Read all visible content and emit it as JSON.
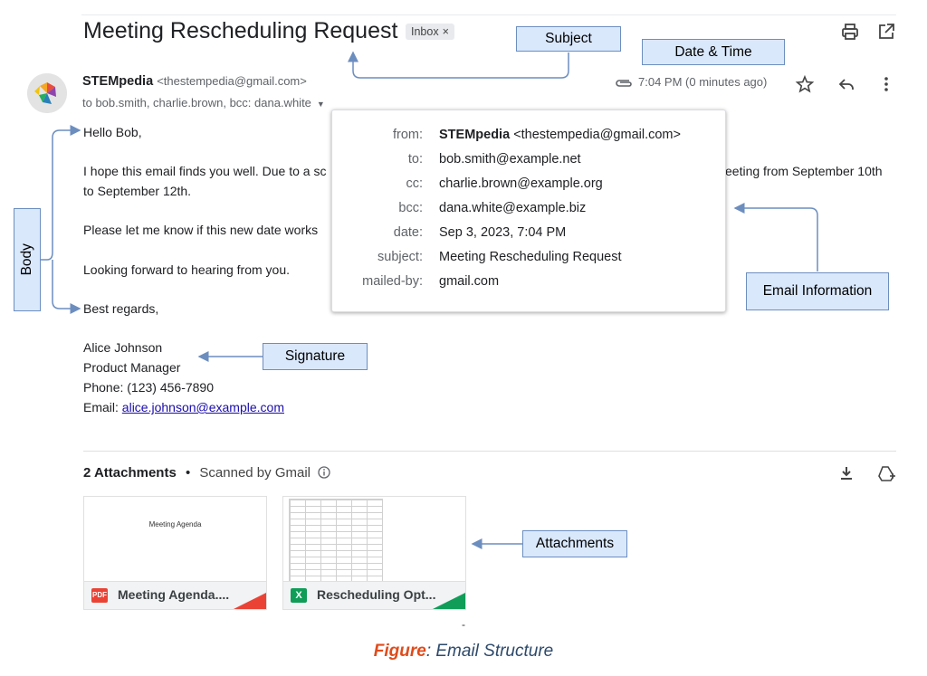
{
  "email": {
    "subject": "Meeting Rescheduling Request",
    "label_badge": "Inbox",
    "label_close": "×",
    "sender_name": "STEMpedia",
    "sender_addr": "<thestempedia@gmail.com>",
    "recipients": "to bob.smith, charlie.brown, bcc: dana.white",
    "datetime": "7:04 PM (0 minutes ago)",
    "body": {
      "greeting": "Hello Bob,",
      "para1_start": "I hope this email finds you well. Due to a sc",
      "para1_end": "eeting from September 10th",
      "para1_line2": "to September 12th.",
      "para2": "Please let me know if this new date works",
      "para3": "Looking forward to hearing from you.",
      "closing": "Best regards,"
    },
    "signature": {
      "name": "Alice Johnson",
      "title": "Product Manager",
      "phone": "Phone: (123) 456-7890",
      "email_label": "Email: ",
      "email": "alice.johnson@example.com"
    }
  },
  "details": {
    "from_label": "from:",
    "from_name": "STEMpedia",
    "from_addr": "<thestempedia@gmail.com>",
    "to_label": "to:",
    "to": "bob.smith@example.net",
    "cc_label": "cc:",
    "cc": "charlie.brown@example.org",
    "bcc_label": "bcc:",
    "bcc": "dana.white@example.biz",
    "date_label": "date:",
    "date": "Sep 3, 2023, 7:04 PM",
    "subject_label": "subject:",
    "subject": "Meeting Rescheduling Request",
    "mailedby_label": "mailed-by:",
    "mailedby": "gmail.com"
  },
  "attachments": {
    "count_label": "2 Attachments",
    "separator": "•",
    "scanned": "Scanned by Gmail",
    "files": [
      {
        "name": "Meeting Agenda....",
        "type": "PDF",
        "preview_title": "Meeting Agenda",
        "color": "#ea4335"
      },
      {
        "name": "Rescheduling Opt...",
        "type": "X",
        "color": "#0f9d58"
      }
    ]
  },
  "annotations": {
    "subject": "Subject",
    "datetime": "Date & Time",
    "body": "Body",
    "email_info": "Email Information",
    "signature": "Signature",
    "attachments": "Attachments"
  },
  "caption": {
    "figure_word": "Figure",
    "text": ": Email Structure",
    "dash": "-"
  },
  "colors": {
    "callout_fill": "#dae8fc",
    "callout_border": "#6c8ebf",
    "arrow": "#6c8ebf",
    "link": "#1a0dab"
  }
}
